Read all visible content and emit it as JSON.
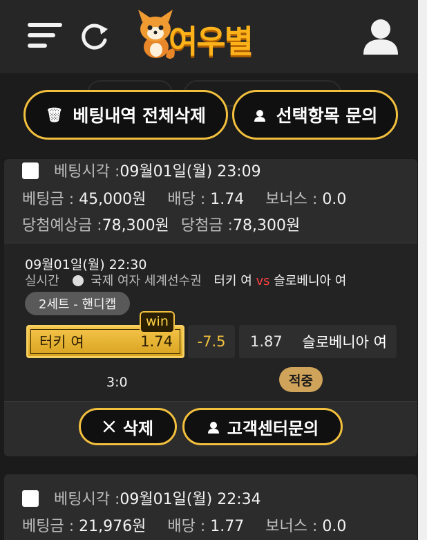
{
  "header": {
    "logo_text": "여우별"
  },
  "actions": {
    "delete_all_label": "베팅내역 전체삭제",
    "inquire_selected_label": "선택항목 문의"
  },
  "bets": [
    {
      "bet_time_label": "베팅시각 :",
      "bet_time": "09월01일(월) 23:09",
      "amount_label": "베팅금 :",
      "amount": "45,000원",
      "odds_label": "배당 :",
      "odds": "1.74",
      "bonus_label": "보너스 :",
      "bonus": "0.0",
      "expected_label": "당첨예상금 :",
      "expected": "78,300원",
      "won_label": "당첨금 :",
      "won": "78,300원",
      "game": {
        "time": "09월01일(월) 22:30",
        "type": "실시간",
        "league": "국제 여자 세계선수권",
        "home": "터키 여",
        "vs": "vs",
        "away": "슬로베니아 여",
        "market": "2세트 - 핸디캡",
        "home_pick": "터키 여",
        "home_odds": "1.74",
        "handicap": "-7.5",
        "away_odds": "1.87",
        "away_pick": "슬로베니아 여",
        "win_badge": "win",
        "score": "3:0",
        "result": "적중"
      },
      "delete_label": "삭제",
      "support_label": "고객센터문의"
    },
    {
      "bet_time_label": "베팅시각 :",
      "bet_time": "09월01일(월) 22:34",
      "amount_label": "베팅금 :",
      "amount": "21,976원",
      "odds_label": "배당 :",
      "odds": "1.77",
      "bonus_label": "보너스 :",
      "bonus": "0.0"
    }
  ],
  "colors": {
    "accent": "#f3c03d",
    "background": "#1b1b1b",
    "card": "#2c2c2c",
    "vs": "#ff4040"
  },
  "icons": [
    "hamburger-icon",
    "refresh-icon",
    "user-icon",
    "trash-icon",
    "headset-icon",
    "close-icon",
    "volleyball-icon"
  ]
}
